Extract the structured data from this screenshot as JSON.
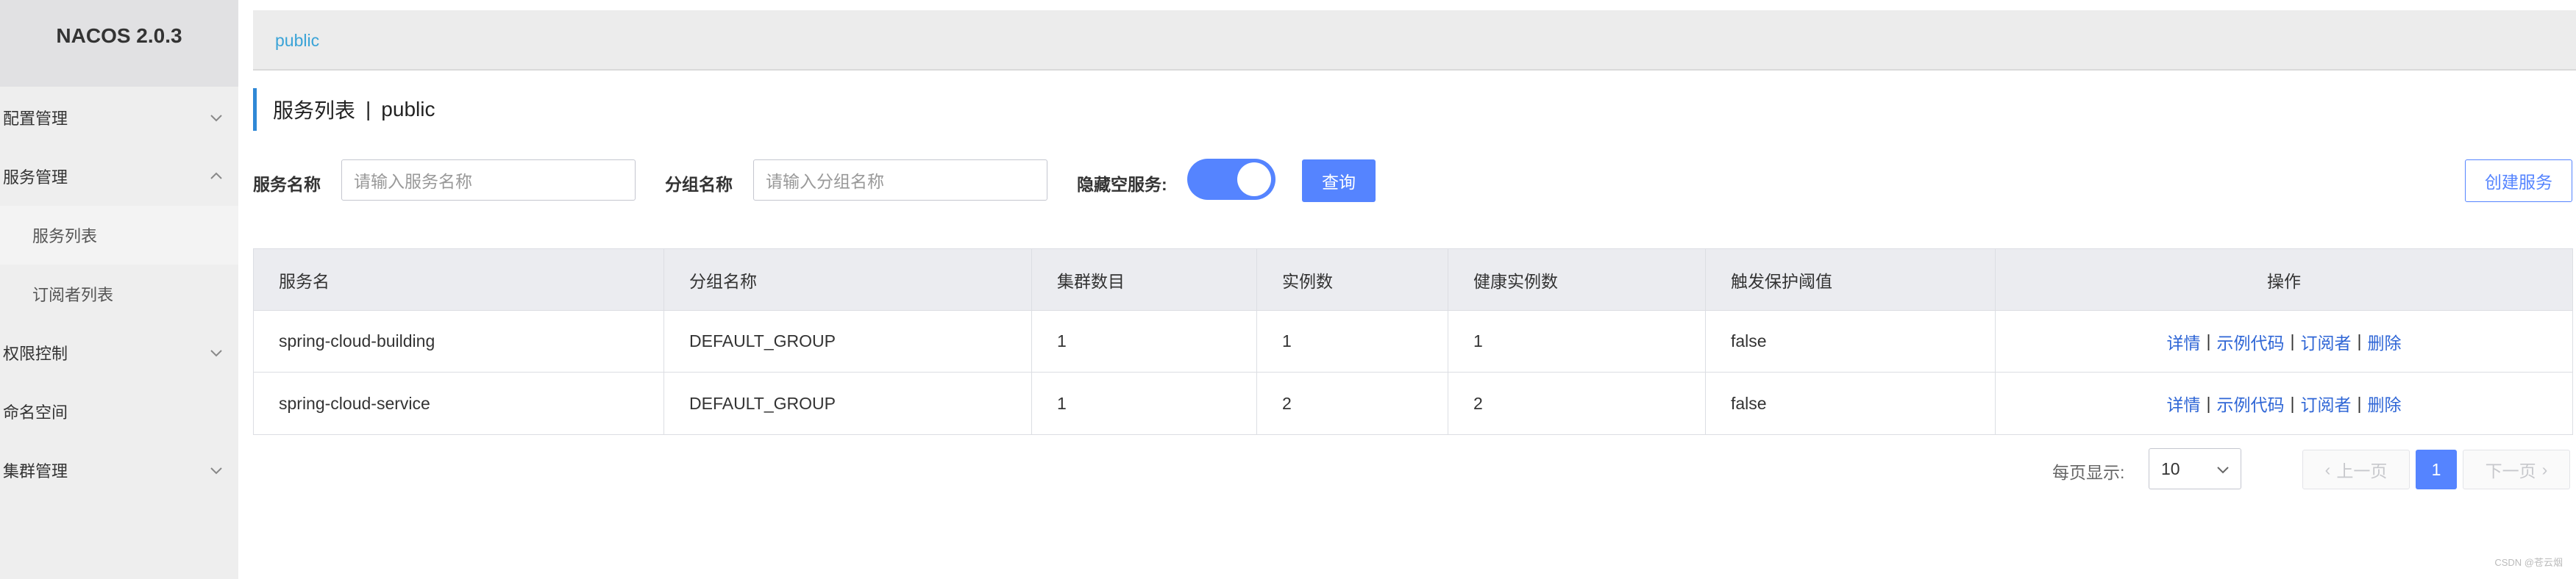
{
  "app": {
    "brand": "NACOS 2.0.3"
  },
  "sidebar": {
    "items": [
      {
        "label": "配置管理"
      },
      {
        "label": "服务管理"
      },
      {
        "label": "服务列表"
      },
      {
        "label": "订阅者列表"
      },
      {
        "label": "权限控制"
      },
      {
        "label": "命名空间"
      },
      {
        "label": "集群管理"
      }
    ]
  },
  "topbar": {
    "namespace": "public"
  },
  "page": {
    "title": "服务列表",
    "separator": "|",
    "namespace": "public"
  },
  "filters": {
    "service_name_label": "服务名称",
    "service_name_placeholder": "请输入服务名称",
    "group_name_label": "分组名称",
    "group_name_placeholder": "请输入分组名称",
    "hide_empty_label": "隐藏空服务:",
    "hide_empty_enabled": true,
    "query_button": "查询",
    "create_button": "创建服务"
  },
  "table": {
    "headers": [
      "服务名",
      "分组名称",
      "集群数目",
      "实例数",
      "健康实例数",
      "触发保护阈值",
      "操作"
    ],
    "rows": [
      [
        "spring-cloud-building",
        "DEFAULT_GROUP",
        "1",
        "1",
        "1",
        "false"
      ],
      [
        "spring-cloud-service",
        "DEFAULT_GROUP",
        "1",
        "2",
        "2",
        "false"
      ]
    ],
    "actions": [
      "详情",
      "示例代码",
      "订阅者",
      "删除"
    ],
    "action_separator": "|"
  },
  "pagination": {
    "page_size_label": "每页显示:",
    "page_size": "10",
    "prev": "上一页",
    "next": "下一页",
    "current_page": "1"
  },
  "watermark": "CSDN @苍云烟",
  "colors": {
    "primary": "#5584ff",
    "link": "#2f66d6",
    "crumb": "#39a3d7",
    "accent_bar": "#2f88d6"
  }
}
